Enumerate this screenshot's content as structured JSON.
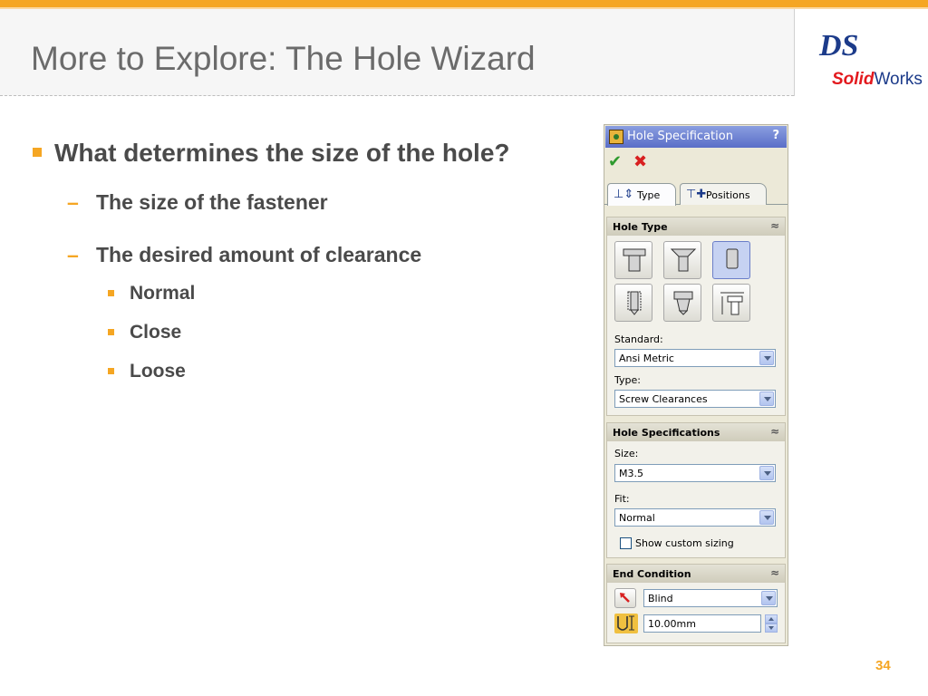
{
  "slide": {
    "title": "More to Explore: The Hole Wizard",
    "page_number": "34",
    "logo": {
      "ds": "DS",
      "solid": "Solid",
      "works": "Works"
    }
  },
  "bullets": {
    "question": "What determines the size of the hole?",
    "answers": [
      "The size of the fastener",
      "The desired amount of clearance"
    ],
    "clearance_types": [
      "Normal",
      "Close",
      "Loose"
    ]
  },
  "panel": {
    "title": "Hole Specification",
    "help": "?",
    "ok": "✔",
    "cancel": "✖",
    "tabs": [
      {
        "label": "Type",
        "icon": "type-tab-icon"
      },
      {
        "label": "Positions",
        "icon": "positions-tab-icon"
      }
    ],
    "hole_type": {
      "header": "Hole Type",
      "collapse": "≈",
      "buttons": [
        "counterbore",
        "countersink",
        "hole",
        "tap",
        "pipe-tap",
        "legacy"
      ],
      "selected": "hole",
      "standard_label": "Standard:",
      "standard_value": "Ansi Metric",
      "type_label": "Type:",
      "type_value": "Screw Clearances"
    },
    "hole_specs": {
      "header": "Hole Specifications",
      "collapse": "≈",
      "size_label": "Size:",
      "size_value": "M3.5",
      "fit_label": "Fit:",
      "fit_value": "Normal",
      "custom_label": "Show custom sizing"
    },
    "end_condition": {
      "header": "End Condition",
      "collapse": "≈",
      "condition_value": "Blind",
      "depth_value": "10.00mm"
    }
  },
  "colors": {
    "accent": "#f5a623",
    "title_text": "#6b6b6b",
    "body_text": "#4a4a4a"
  }
}
